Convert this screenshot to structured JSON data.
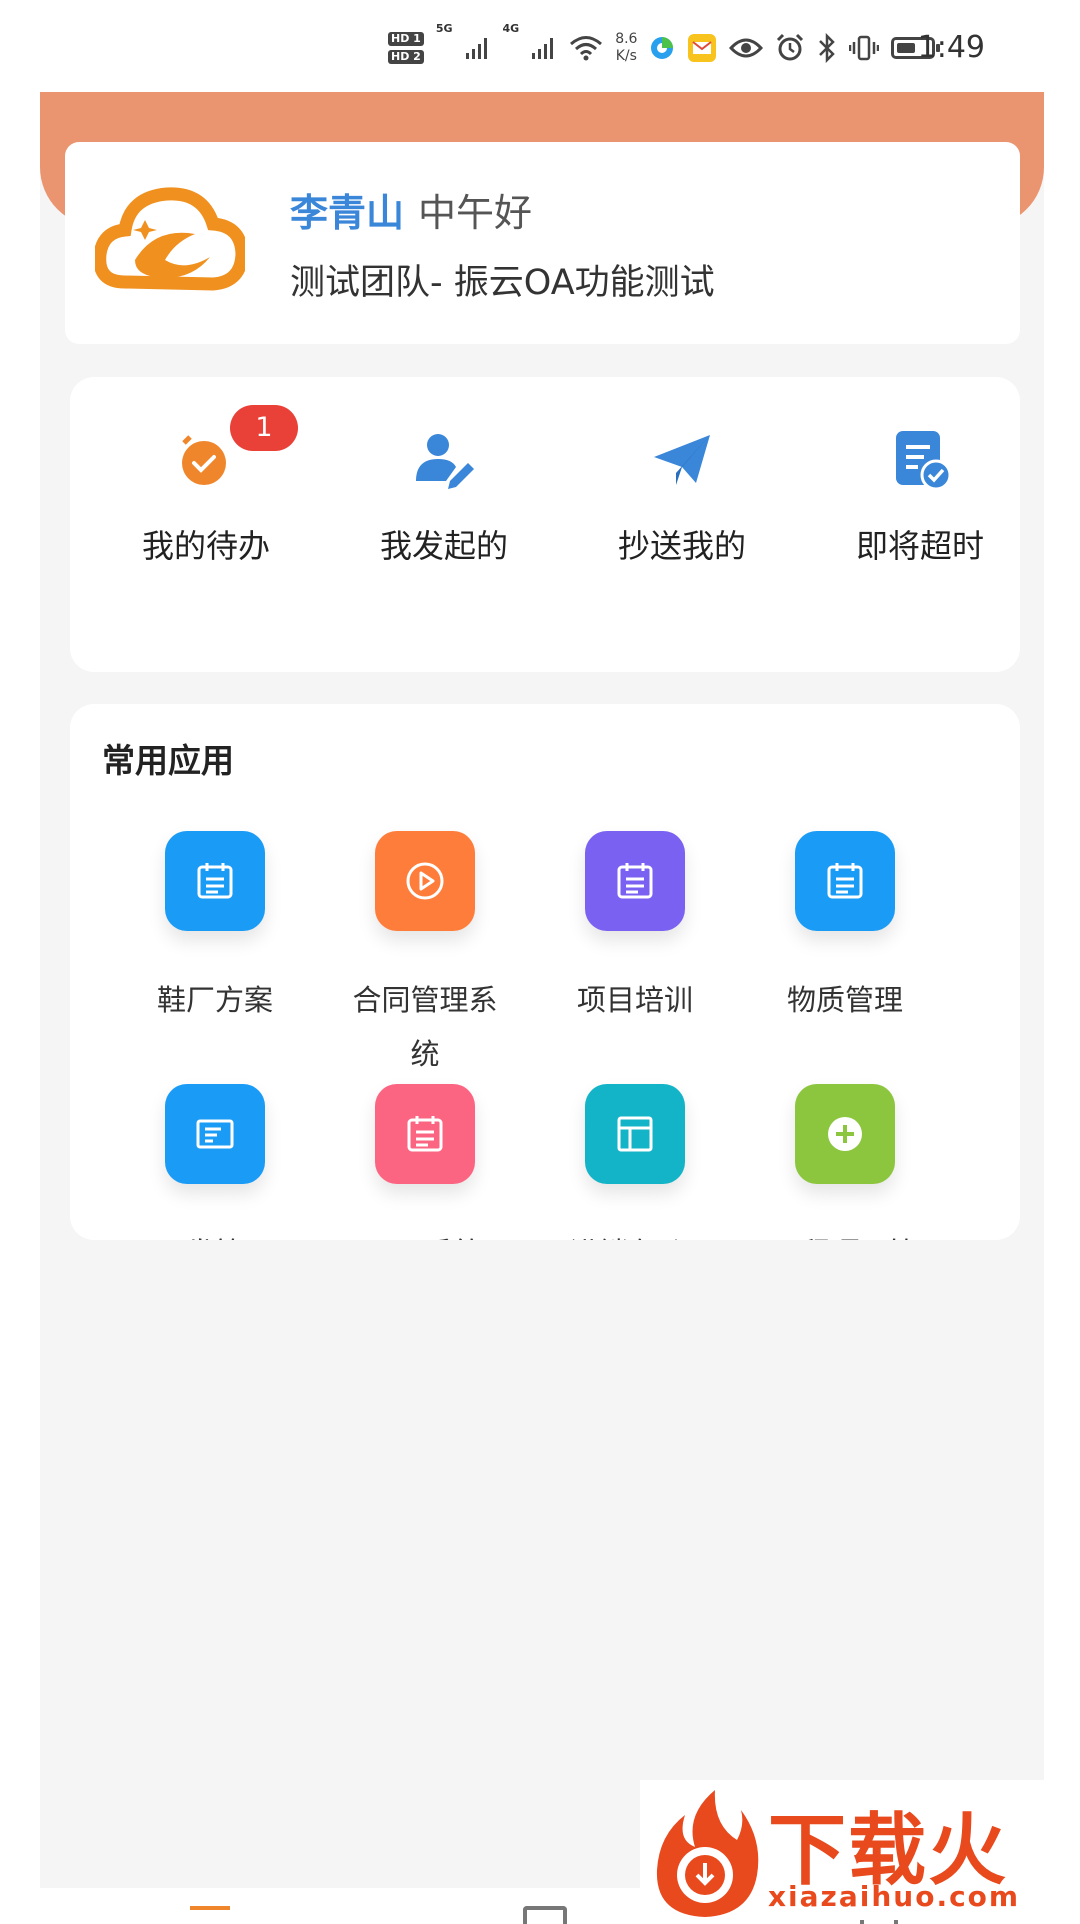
{
  "status_bar": {
    "sim1_label": "HD 1",
    "sim2_label": "HD 2",
    "network1": "5G",
    "network2": "4G",
    "speed_value": "8.6",
    "speed_unit": "K/s",
    "time": "1:49",
    "battery_level": 0.55
  },
  "user": {
    "name": "李青山",
    "greeting": "中午好",
    "team": "测试团队- 振云OA功能测试"
  },
  "quick_actions": [
    {
      "label": "我的待办",
      "badge": "1",
      "icon": "alarm-clock-icon",
      "color": "#f0862c"
    },
    {
      "label": "我发起的",
      "icon": "user-edit-icon",
      "color": "#3a86d8"
    },
    {
      "label": "抄送我的",
      "icon": "paper-plane-icon",
      "color": "#3a86d8"
    },
    {
      "label": "即将超时",
      "icon": "document-check-icon",
      "color": "#3a86d8"
    }
  ],
  "apps_section": {
    "title": "常用应用",
    "apps": [
      {
        "label": "鞋厂方案",
        "color": "#1a9bf6",
        "icon": "calendar-icon"
      },
      {
        "label": "合同管理系统",
        "color": "#ff7d3a",
        "icon": "play-circle-icon"
      },
      {
        "label": "项目培训",
        "color": "#7b61f2",
        "icon": "calendar-icon"
      },
      {
        "label": "物质管理",
        "color": "#1a9bf6",
        "icon": "calendar-icon"
      },
      {
        "label": "研发管理",
        "color": "#1a9bf6",
        "icon": "id-card-icon"
      },
      {
        "label": "ERP系统",
        "color": "#fb6582",
        "icon": "calendar-icon"
      },
      {
        "label": "进销存_订",
        "color": "#14b4c8",
        "icon": "layout-icon"
      },
      {
        "label": "工程项目管",
        "color": "#8cc63f",
        "icon": "plus-circle-icon"
      }
    ]
  },
  "watermark": {
    "text": "下载火",
    "url": "xiazaihuo.com"
  }
}
